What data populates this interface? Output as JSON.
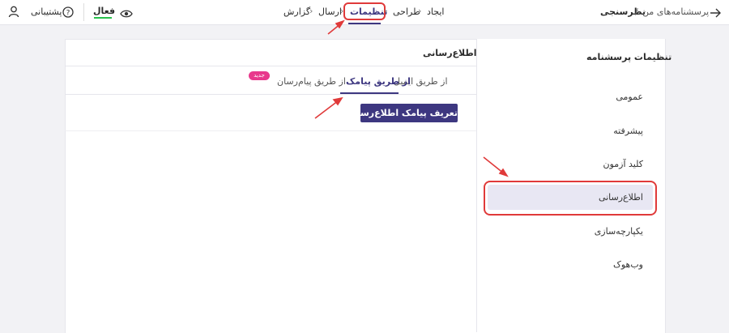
{
  "header": {
    "breadcrumb_root": "پرسشنامه‌های من",
    "breadcrumb_sep": "/",
    "breadcrumb_current": "نظرسنجی",
    "steps": [
      {
        "label": "ایجاد"
      },
      {
        "label": "طراحی"
      },
      {
        "label": "تنظیمات"
      },
      {
        "label": "ارسال"
      },
      {
        "label": "گزارش"
      }
    ],
    "step_sep": "›",
    "status": "فعال",
    "support": "پشتیبانی"
  },
  "sidebar": {
    "title": "تنظیمات پرسشنامه",
    "items": [
      {
        "label": "عمومی"
      },
      {
        "label": "پیشرفته"
      },
      {
        "label": "کلید آزمون"
      },
      {
        "label": "اطلاع‌رسانی"
      },
      {
        "label": "یکپارچه‌سازی"
      },
      {
        "label": "وب‌هوک"
      }
    ]
  },
  "panel": {
    "title": "اطلاع‌رسانی",
    "tabs": [
      {
        "label": "از طریق ایمیل"
      },
      {
        "label": "از طریق پیامک"
      },
      {
        "label": "از طریق پیام‌رسان"
      }
    ],
    "badge": "جدید",
    "action_button": "تعریف پیامک اطلاع‌رسانی"
  },
  "colors": {
    "accent": "#3d3780",
    "active_green": "#27c24c",
    "badge_pink": "#e8398c",
    "highlight_red": "#e03a3a",
    "selected_bg": "#e8e7f3"
  }
}
